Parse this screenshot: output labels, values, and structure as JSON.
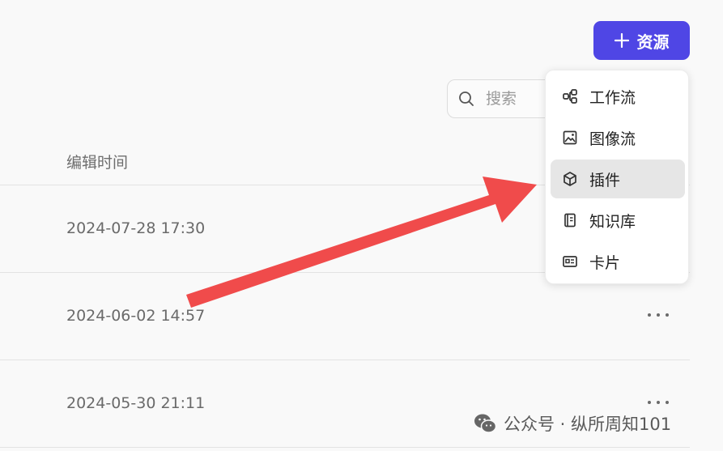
{
  "header": {
    "add_button_label": "资源"
  },
  "search": {
    "placeholder": "搜索",
    "value": ""
  },
  "table": {
    "column_header": "编辑时间",
    "rows": [
      {
        "time": "2024-07-28 17:30"
      },
      {
        "time": "2024-06-02 14:57"
      },
      {
        "time": "2024-05-30 21:11"
      }
    ]
  },
  "menu": {
    "items": [
      {
        "label": "工作流",
        "icon": "workflow-icon"
      },
      {
        "label": "图像流",
        "icon": "image-flow-icon"
      },
      {
        "label": "插件",
        "icon": "plugin-icon",
        "active": true
      },
      {
        "label": "知识库",
        "icon": "knowledge-base-icon"
      },
      {
        "label": "卡片",
        "icon": "card-icon"
      }
    ]
  },
  "watermark": {
    "text": "公众号 · 纵所周知101"
  },
  "colors": {
    "accent": "#4f46e5",
    "arrow": "#f04b4b"
  }
}
